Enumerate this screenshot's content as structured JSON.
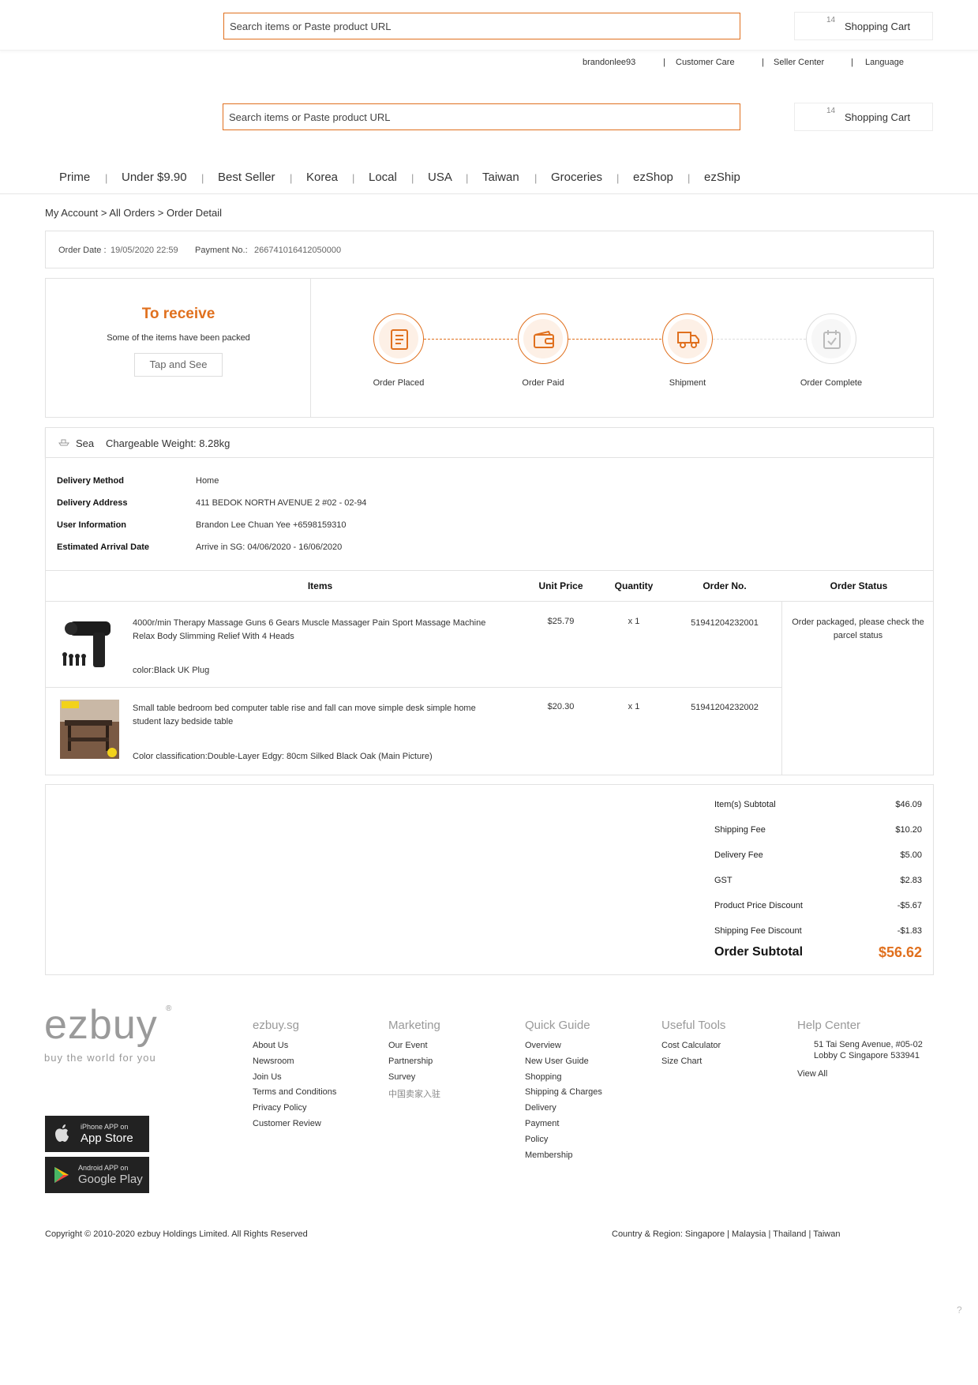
{
  "header": {
    "search_placeholder": "Search items or Paste product URL",
    "cart_count": "14",
    "cart_label": "Shopping Cart",
    "username": "brandonlee93",
    "customer_care": "Customer Care",
    "seller_center": "Seller Center",
    "language": "Language"
  },
  "nav": [
    "Prime",
    "Under $9.90",
    "Best Seller",
    "Korea",
    "Local",
    "USA",
    "Taiwan",
    "Groceries",
    "ezShop",
    "ezShip"
  ],
  "breadcrumb": {
    "my_account": "My Account",
    "all_orders": "All Orders",
    "order_detail": "Order Detail",
    "sep": ">"
  },
  "order_meta": {
    "date_label": "Order Date :",
    "date_value": "19/05/2020 22:59",
    "payment_label": "Payment No.:",
    "payment_value": "266741016412050000"
  },
  "status": {
    "title": "To receive",
    "subtitle": "Some of the items have been packed",
    "button": "Tap and See",
    "steps": [
      "Order Placed",
      "Order Paid",
      "Shipment",
      "Order Complete"
    ]
  },
  "shipping": {
    "mode": "Sea",
    "weight": "Chargeable Weight: 8.28kg",
    "rows": [
      {
        "label": "Delivery Method",
        "value": "Home"
      },
      {
        "label": "Delivery Address",
        "value": "411 BEDOK NORTH AVENUE 2 #02 - 02-94"
      },
      {
        "label": "User Information",
        "value": "Brandon Lee Chuan Yee +6598159310"
      },
      {
        "label": "Estimated Arrival Date",
        "value": "Arrive in SG: 04/06/2020 - 16/06/2020"
      }
    ]
  },
  "table": {
    "headers": [
      "Items",
      "Unit Price",
      "Quantity",
      "Order No.",
      "Order Status"
    ],
    "order_status": "Order packaged, please check the parcel status",
    "rows": [
      {
        "title": "4000r/min Therapy Massage Guns 6 Gears Muscle Massager Pain Sport Massage Machine Relax Body Slimming Relief With 4 Heads",
        "variant": "color:Black UK Plug",
        "price": "$25.79",
        "qty": "x 1",
        "order_no": "51941204232001"
      },
      {
        "title": "Small table bedroom bed computer table rise and fall can move simple desk simple home student lazy bedside table",
        "variant": "Color classification:Double-Layer Edgy: 80cm Silked Black Oak (Main Picture)",
        "price": "$20.30",
        "qty": "x 1",
        "order_no": "51941204232002"
      }
    ]
  },
  "summary": {
    "rows": [
      {
        "label": "Item(s) Subtotal",
        "value": "$46.09"
      },
      {
        "label": "Shipping Fee",
        "value": "$10.20"
      },
      {
        "label": "Delivery Fee",
        "value": "$5.00"
      },
      {
        "label": "GST",
        "value": "$2.83"
      },
      {
        "label": "Product Price Discount",
        "value": "-$5.67"
      },
      {
        "label": "Shipping Fee Discount",
        "value": "-$1.83"
      }
    ],
    "total_label": "Order Subtotal",
    "total_value": "$56.62"
  },
  "footer": {
    "logo": "ezbuy",
    "tagline": "buy the world for you",
    "registered": "®",
    "columns": [
      {
        "title": "ezbuy.sg",
        "links": [
          "About Us",
          "Newsroom",
          "Join Us",
          "Terms and Conditions",
          "Privacy Policy",
          "Customer Review"
        ]
      },
      {
        "title": "Marketing",
        "links": [
          "Our Event",
          "Partnership",
          "Survey",
          "中国卖家入驻"
        ]
      },
      {
        "title": "Quick Guide",
        "links": [
          "Overview",
          "New User Guide",
          "Shopping",
          "Shipping & Charges",
          "Delivery",
          "Payment",
          "Policy",
          "Membership"
        ]
      },
      {
        "title": "Useful Tools",
        "links": [
          "Cost Calculator",
          "Size Chart"
        ]
      }
    ],
    "help": {
      "title": "Help Center",
      "address1": "51 Tai Seng Avenue, #05-02",
      "address2": "Lobby C Singapore 533941",
      "view_all": "View All"
    },
    "app_store": {
      "small": "iPhone APP on",
      "big": "App Store"
    },
    "google_play": {
      "small": "Android APP on",
      "big": "Google Play"
    },
    "copyright": "Copyright © 2010-2020 ezbuy Holdings Limited. All Rights Reserved",
    "region": "Country & Region: Singapore | Malaysia | Thailand | Taiwan"
  },
  "help_mark": "?",
  "colors": {
    "accent": "#e0701e",
    "border": "#e2e2e2"
  }
}
